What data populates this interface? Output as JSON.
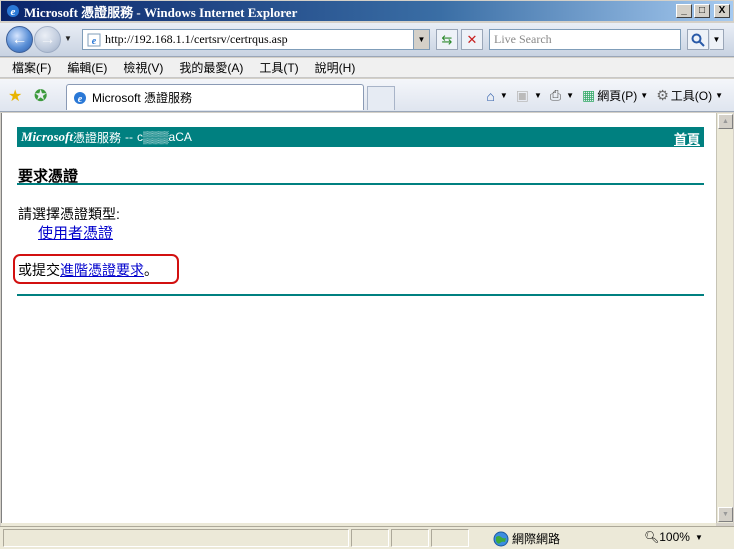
{
  "window": {
    "title": "Microsoft 憑證服務 - Windows Internet Explorer",
    "minimize": "_",
    "maximize": "□",
    "close": "X"
  },
  "address": {
    "url": "http://192.168.1.1/certsrv/certrqus.asp",
    "search_placeholder": "Live Search"
  },
  "menu": [
    "檔案(F)",
    "編輯(E)",
    "檢視(V)",
    "我的最愛(A)",
    "工具(T)",
    "說明(H)"
  ],
  "tab": {
    "title": "Microsoft 憑證服務"
  },
  "commands": {
    "page": "網頁(P)",
    "tools": "工具(O)"
  },
  "page": {
    "header": {
      "brand": "Microsoft",
      "service": "憑證服務",
      "separator": "--",
      "ca_name": "c▒▒▒aCA",
      "home_link": "首頁"
    },
    "heading": "要求憑證",
    "prompt": "請選擇憑證類型:",
    "user_cert_link": "使用者憑證",
    "submit_prefix": "或提交",
    "advanced_link": "進階憑證要求",
    "submit_suffix": "。"
  },
  "status": {
    "zone": "網際網路",
    "zoom": "100%"
  },
  "colors": {
    "teal": "#008080",
    "link": "#0000cc",
    "highlight": "#d21010"
  }
}
